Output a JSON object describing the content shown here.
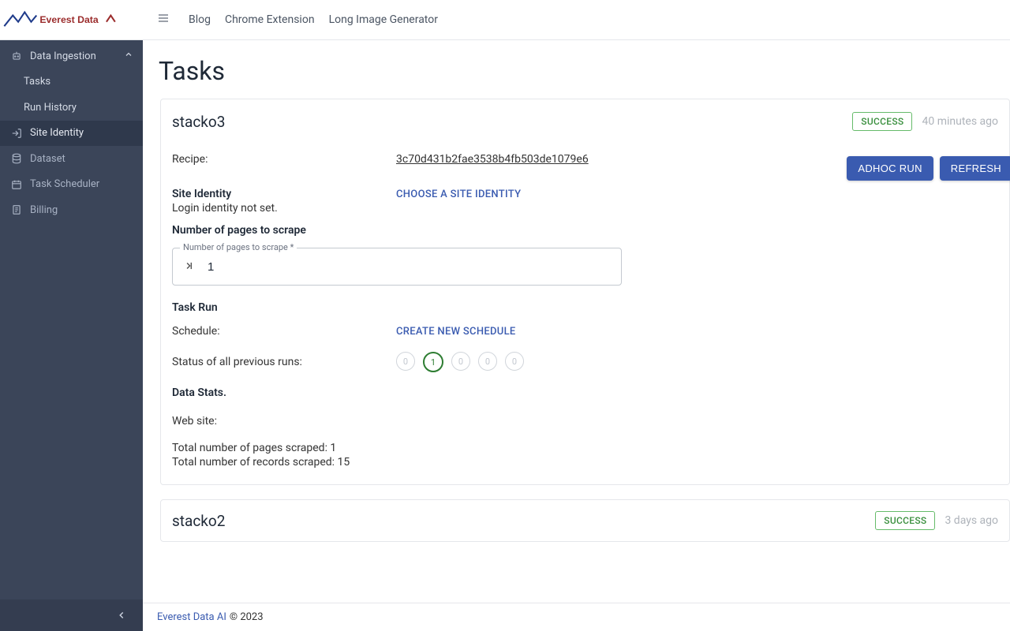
{
  "brand": "Everest Data",
  "topbar": {
    "links": [
      "Blog",
      "Chrome Extension",
      "Long Image Generator"
    ]
  },
  "sidebar": {
    "group": "Data Ingestion",
    "sub": [
      "Tasks",
      "Run History"
    ],
    "items": [
      {
        "name": "site-identity",
        "label": "Site Identity"
      },
      {
        "name": "dataset",
        "label": "Dataset"
      },
      {
        "name": "task-scheduler",
        "label": "Task Scheduler"
      },
      {
        "name": "billing",
        "label": "Billing"
      }
    ]
  },
  "page": {
    "title": "Tasks"
  },
  "task1": {
    "name": "stacko3",
    "status": "SUCCESS",
    "time": "40 minutes ago",
    "recipe_label": "Recipe:",
    "recipe_value": "3c70d431b2fae3538b4fb503de1079e6",
    "adhoc": "ADHOC RUN",
    "refresh": "REFRESH",
    "site_identity_label": "Site Identity",
    "choose_site": "CHOOSE A SITE IDENTITY",
    "login_not_set": "Login identity not set.",
    "pages_head": "Number of pages to scrape",
    "pages_float": "Number of pages to scrape *",
    "pages_value": "1",
    "task_run": "Task Run",
    "schedule_label": "Schedule:",
    "create_schedule": "CREATE NEW SCHEDULE",
    "prev_runs_label": "Status of all previous runs:",
    "circles": [
      "0",
      "1",
      "0",
      "0",
      "0"
    ],
    "data_stats": "Data Stats.",
    "web_site": "Web site:",
    "total_pages": "Total number of pages scraped: 1",
    "total_records": "Total number of records scraped: 15"
  },
  "task2": {
    "name": "stacko2",
    "status": "SUCCESS",
    "time": "3 days ago"
  },
  "footer": {
    "link": "Everest Data AI",
    "copy": "© 2023"
  }
}
